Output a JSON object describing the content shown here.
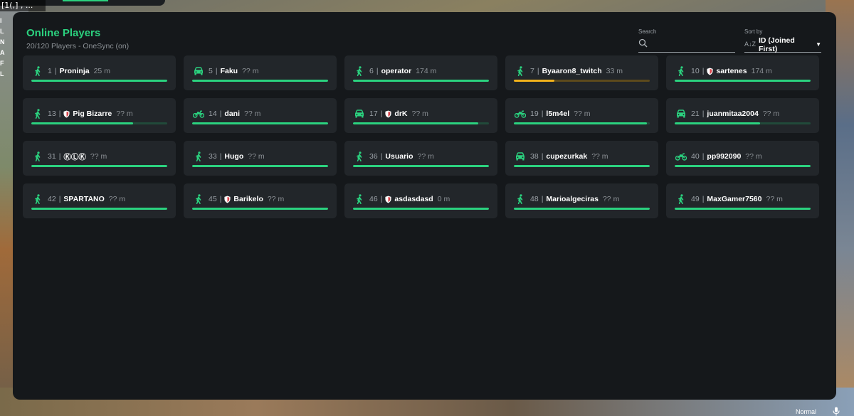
{
  "panel": {
    "title": "Online Players",
    "subtitle": "20/120 Players - OneSync (on)"
  },
  "search": {
    "label": "Search",
    "placeholder": "",
    "value": ""
  },
  "sort": {
    "label": "Sort by",
    "value": "ID (Joined First)",
    "icon_text": "A↓Z"
  },
  "players": [
    {
      "id": "1",
      "name": "Proninja",
      "distance": "25 m",
      "vehicle": "walk-icon",
      "admin": false,
      "health": 1.0,
      "bar": "green"
    },
    {
      "id": "5",
      "name": "Faku",
      "distance": "?? m",
      "vehicle": "car-icon",
      "admin": false,
      "health": 1.0,
      "bar": "green"
    },
    {
      "id": "6",
      "name": "operator",
      "distance": "174 m",
      "vehicle": "walk-icon",
      "admin": false,
      "health": 1.0,
      "bar": "green"
    },
    {
      "id": "7",
      "name": "Byaaron8_twitch",
      "distance": "33 m",
      "vehicle": "walk-icon",
      "admin": false,
      "health": 0.3,
      "bar": "yellow"
    },
    {
      "id": "10",
      "name": "sartenes",
      "distance": "174 m",
      "vehicle": "walk-icon",
      "admin": true,
      "health": 1.0,
      "bar": "green"
    },
    {
      "id": "13",
      "name": "Pig Bizarre",
      "distance": "?? m",
      "vehicle": "walk-icon",
      "admin": true,
      "health": 0.75,
      "bar": "green"
    },
    {
      "id": "14",
      "name": "dani",
      "distance": "?? m",
      "vehicle": "motorcycle-icon",
      "admin": false,
      "health": 1.0,
      "bar": "green"
    },
    {
      "id": "17",
      "name": "drK",
      "distance": "?? m",
      "vehicle": "car-icon",
      "admin": true,
      "health": 0.92,
      "bar": "green"
    },
    {
      "id": "19",
      "name": "l5m4el",
      "distance": "?? m",
      "vehicle": "motorcycle-icon",
      "admin": false,
      "health": 0.98,
      "bar": "green"
    },
    {
      "id": "21",
      "name": "juanmitaa2004",
      "distance": "?? m",
      "vehicle": "car-icon",
      "admin": false,
      "health": 0.63,
      "bar": "green"
    },
    {
      "id": "31",
      "name": "ⓀⓁⓀ",
      "distance": "?? m",
      "vehicle": "walk-icon",
      "admin": false,
      "health": 1.0,
      "bar": "green"
    },
    {
      "id": "33",
      "name": "Hugo",
      "distance": "?? m",
      "vehicle": "walk-icon",
      "admin": false,
      "health": 1.0,
      "bar": "green"
    },
    {
      "id": "36",
      "name": "Usuario",
      "distance": "?? m",
      "vehicle": "walk-icon",
      "admin": false,
      "health": 1.0,
      "bar": "green"
    },
    {
      "id": "38",
      "name": "cupezurkak",
      "distance": "?? m",
      "vehicle": "car-icon",
      "admin": false,
      "health": 1.0,
      "bar": "green"
    },
    {
      "id": "40",
      "name": "pp992090",
      "distance": "?? m",
      "vehicle": "motorcycle-icon",
      "admin": false,
      "health": 1.0,
      "bar": "green"
    },
    {
      "id": "42",
      "name": "SPARTANO",
      "distance": "?? m",
      "vehicle": "walk-icon",
      "admin": false,
      "health": 1.0,
      "bar": "green"
    },
    {
      "id": "45",
      "name": "Barikelo",
      "distance": "?? m",
      "vehicle": "walk-icon",
      "admin": true,
      "health": 1.0,
      "bar": "green"
    },
    {
      "id": "46",
      "name": "asdasdasd",
      "distance": "0 m",
      "vehicle": "walk-icon",
      "admin": true,
      "health": 1.0,
      "bar": "green"
    },
    {
      "id": "48",
      "name": "Marioalgeciras",
      "distance": "?? m",
      "vehicle": "walk-icon",
      "admin": false,
      "health": 1.0,
      "bar": "green"
    },
    {
      "id": "49",
      "name": "MaxGamer7560",
      "distance": "?? m",
      "vehicle": "walk-icon",
      "admin": false,
      "health": 1.0,
      "bar": "green"
    }
  ],
  "chat_snippet": "[1(,] , ...",
  "side_letters": [
    "I",
    "L",
    "N",
    "A",
    "F",
    "L"
  ],
  "voice": {
    "mode": "Normal"
  },
  "colors": {
    "accent": "#2bd27f",
    "warning": "#f2b21b",
    "panel_bg": "#15181b",
    "card_bg": "#22262a"
  }
}
